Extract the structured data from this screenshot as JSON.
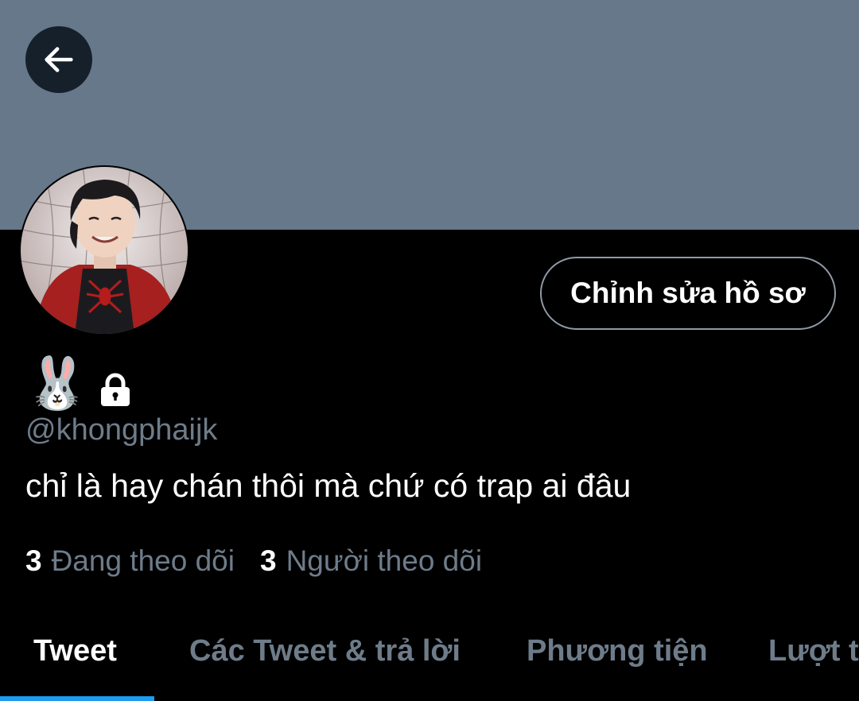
{
  "profile": {
    "name_emoji": "🐰",
    "handle": "@khongphaijk",
    "bio": "chỉ là hay chán thôi mà chứ có trap ai đâu",
    "edit_button_label": "Chỉnh sửa hồ sơ"
  },
  "stats": {
    "following_count": "3",
    "following_label": "Đang theo dõi",
    "followers_count": "3",
    "followers_label": "Người theo dõi"
  },
  "tabs": [
    {
      "label": "Tweet",
      "active": true
    },
    {
      "label": "Các Tweet & trả lời",
      "active": false
    },
    {
      "label": "Phương tiện",
      "active": false
    },
    {
      "label": "Lượt thích",
      "active": false
    }
  ],
  "colors": {
    "banner": "#66788a",
    "accent": "#1d9bf0",
    "muted_text": "#6e7c8a",
    "background": "#000000"
  },
  "icons": {
    "back": "arrow-left-icon",
    "lock": "lock-icon"
  }
}
